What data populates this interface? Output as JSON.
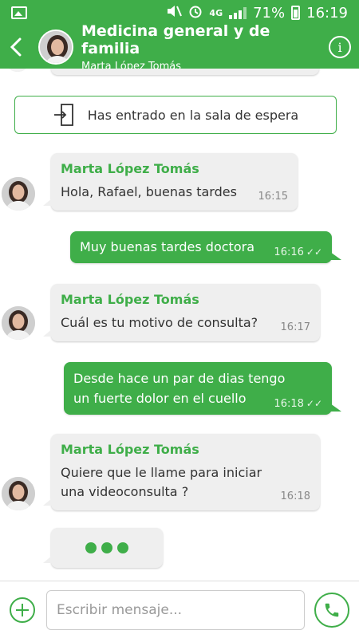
{
  "status_bar": {
    "network": "4G",
    "battery": "71%",
    "time": "16:19"
  },
  "header": {
    "title": "Medicina general y de familia",
    "subtitle": "Marta López Tomás",
    "info_label": "i"
  },
  "system_message": "Has entrado en la sala de espera",
  "messages": [
    {
      "direction": "in",
      "sender": "Marta López Tomás",
      "text": "Hola, Rafael, buenas tardes",
      "time": "16:15"
    },
    {
      "direction": "out",
      "text": "Muy buenas tardes doctora",
      "time": "16:16",
      "status": "✓✓"
    },
    {
      "direction": "in",
      "sender": "Marta López Tomás",
      "text": "Cuál es tu motivo de consulta?",
      "time": "16:17"
    },
    {
      "direction": "out",
      "text": "Desde hace un par de dias tengo un fuerte dolor en el cuello",
      "time": "16:18",
      "status": "✓✓"
    },
    {
      "direction": "in",
      "sender": "Marta López Tomás",
      "text": "Quiere que le llame para iniciar una videoconsulta ?",
      "time": "16:18"
    }
  ],
  "input": {
    "placeholder": "Escribir mensaje..."
  },
  "colors": {
    "accent": "#3fae49",
    "incoming_bubble": "#efefef"
  },
  "icons": [
    "image-icon",
    "mute-icon",
    "alarm-icon",
    "signal-icon",
    "battery-icon",
    "back-icon",
    "info-icon",
    "door-enter-icon",
    "check-double-icon",
    "plus-icon",
    "phone-icon"
  ]
}
